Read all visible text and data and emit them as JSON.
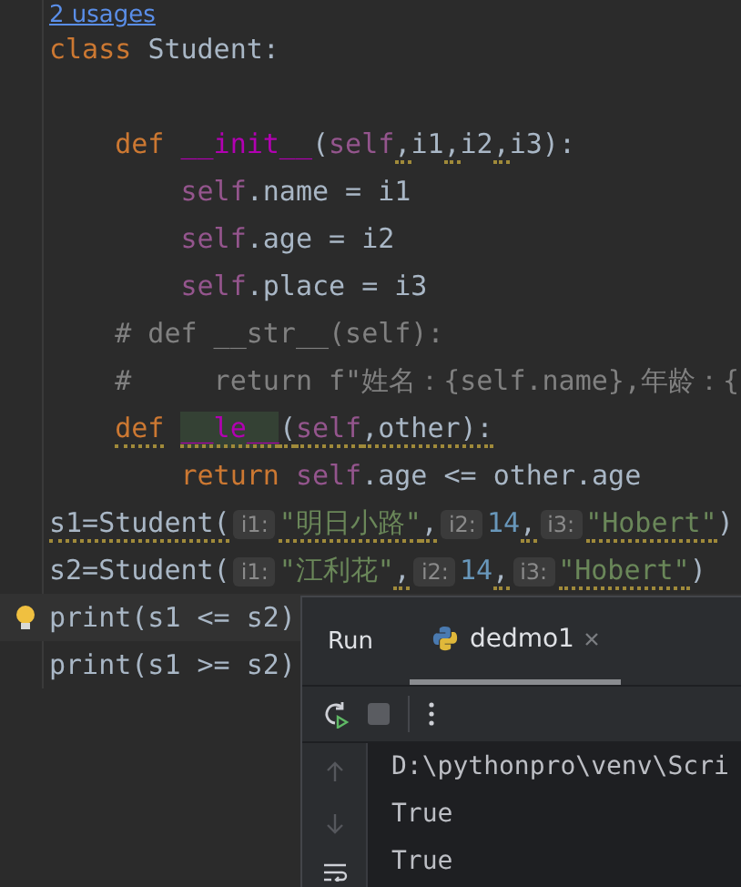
{
  "editor": {
    "usages_link": "2 usages",
    "lines": [
      {
        "current": false,
        "tokens": [
          {
            "text": "class",
            "kind": "keyword"
          },
          {
            "text": " Student:",
            "kind": "plain"
          }
        ]
      },
      {
        "current": false
      },
      {
        "current": false,
        "tokens": [
          {
            "text": "    def",
            "kind": "keyword"
          },
          {
            "text": " __init__",
            "kind": "magic"
          },
          {
            "text": "(",
            "kind": "plain"
          },
          {
            "text": "self",
            "kind": "self"
          },
          {
            "text": ",",
            "kind": "plain",
            "warning": true
          },
          {
            "text": "i1",
            "kind": "plain"
          },
          {
            "text": ",",
            "kind": "plain",
            "warning": true
          },
          {
            "text": "i2",
            "kind": "plain"
          },
          {
            "text": ",",
            "kind": "plain",
            "warning": true
          },
          {
            "text": "i3):",
            "kind": "plain"
          }
        ]
      },
      {
        "current": false,
        "tokens": [
          {
            "text": "        self",
            "kind": "self"
          },
          {
            "text": ".name = i1",
            "kind": "plain"
          }
        ]
      },
      {
        "current": false,
        "tokens": [
          {
            "text": "        self",
            "kind": "self"
          },
          {
            "text": ".age = i2",
            "kind": "plain"
          }
        ]
      },
      {
        "current": false,
        "tokens": [
          {
            "text": "        self",
            "kind": "self"
          },
          {
            "text": ".place = i3",
            "kind": "plain"
          }
        ]
      },
      {
        "current": false,
        "tokens": [
          {
            "text": "    # def __str__(self):",
            "kind": "comment"
          }
        ]
      },
      {
        "current": false,
        "tokens": [
          {
            "text": "    #     return f\"姓名：{self.name},年龄：{",
            "kind": "comment"
          }
        ]
      },
      {
        "current": false,
        "tokens": [
          {
            "text": "    def",
            "kind": "keyword",
            "warning": true
          },
          {
            "text": " __le__",
            "kind": "magic",
            "warning": true,
            "highlighted": true
          },
          {
            "text": "(",
            "kind": "plain",
            "warning": true
          },
          {
            "text": "self",
            "kind": "self",
            "warning": true
          },
          {
            "text": ",other):",
            "kind": "plain",
            "warning": true
          }
        ]
      },
      {
        "current": false,
        "tokens": [
          {
            "text": "        return",
            "kind": "keyword"
          },
          {
            "text": " self",
            "kind": "self"
          },
          {
            "text": ".age <= other.age",
            "kind": "plain"
          }
        ]
      },
      {
        "current": false,
        "tokens": [
          {
            "text": "s1=Student(",
            "kind": "plain",
            "warning": true
          },
          {
            "text": "i1:",
            "kind": "hint"
          },
          {
            "text": "\"明日小路\"",
            "kind": "string",
            "warning": true
          },
          {
            "text": ",",
            "kind": "plain",
            "warning": true
          },
          {
            "text": "i2:",
            "kind": "hint"
          },
          {
            "text": "14",
            "kind": "number"
          },
          {
            "text": ",",
            "kind": "plain",
            "warning": true
          },
          {
            "text": "i3:",
            "kind": "hint"
          },
          {
            "text": "\"Hobert\"",
            "kind": "string",
            "warning": true
          },
          {
            "text": ")",
            "kind": "plain"
          }
        ]
      },
      {
        "current": false,
        "tokens": [
          {
            "text": "s2=Student(",
            "kind": "plain"
          },
          {
            "text": "i1:",
            "kind": "hint"
          },
          {
            "text": "\"江利花\"",
            "kind": "string"
          },
          {
            "text": ",",
            "kind": "plain",
            "warning": true
          },
          {
            "text": "i2:",
            "kind": "hint"
          },
          {
            "text": "14",
            "kind": "number"
          },
          {
            "text": ",",
            "kind": "plain",
            "warning": true
          },
          {
            "text": "i3:",
            "kind": "hint"
          },
          {
            "text": "\"Hobert\"",
            "kind": "string",
            "warning": true
          },
          {
            "text": ")",
            "kind": "plain"
          }
        ]
      },
      {
        "current": true,
        "tokens": [
          {
            "text": "print(s1 <= s2)",
            "kind": "plain"
          }
        ]
      },
      {
        "current": false,
        "tokens": [
          {
            "text": "print(s1 >= s2)",
            "kind": "plain"
          }
        ]
      }
    ]
  },
  "run_panel": {
    "title": "Run",
    "tabs": [
      {
        "label": "dedmo1",
        "selected": true
      }
    ],
    "console": [
      "D:\\pythonpro\\venv\\Scri",
      "True",
      "True"
    ]
  }
}
